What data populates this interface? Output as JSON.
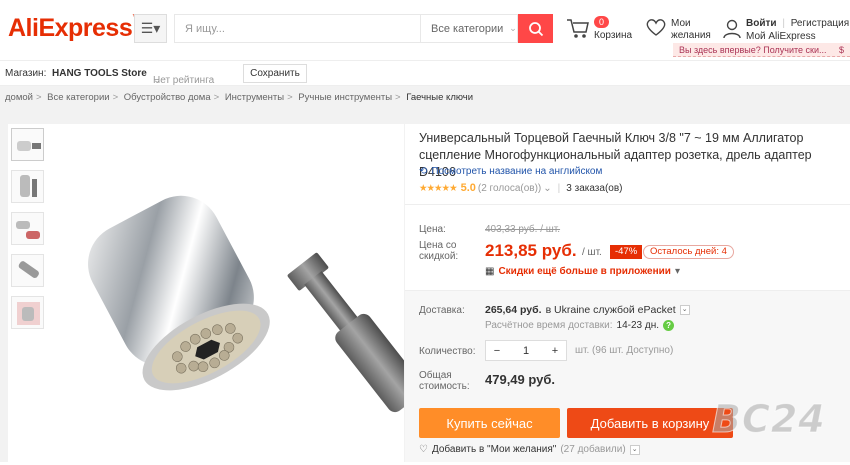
{
  "header": {
    "logo": "AliExpress",
    "search_placeholder": "Я ищу...",
    "search_category": "Все категории",
    "cart_count": "0",
    "cart_label": "Корзина",
    "wishlist_label": "Мои желания",
    "login": "Войти",
    "register": "Регистрация",
    "my_account": "Мой AliExpress",
    "promo": "Вы здесь впервые? Получите ски...",
    "promo_currency": "$"
  },
  "store_bar": {
    "store_label": "Магазин:",
    "store_name": "HANG TOOLS Store",
    "rating": "Нет рейтинга",
    "save": "Сохранить"
  },
  "breadcrumb": [
    "домой",
    "Все категории",
    "Обустройство дома",
    "Инструменты",
    "Ручные инструменты",
    "Гаечные ключи"
  ],
  "product": {
    "title": "Универсальный Торцевой Гаечный Ключ 3/8 \"7 ~ 19 мм Аллигатор сцепление Многофункциональный адаптер розетка, дрель адаптер D4106",
    "translate_link": "Посмотреть название на английском",
    "stars": "★★★★★",
    "rating": "5.0",
    "votes": "(2 голоса(ов))",
    "orders": "3 заказа(ов)",
    "price_label": "Цена:",
    "old_price": "403,33 руб. / шт.",
    "discount_label_line1": "Цена со",
    "discount_label_line2": "скидкой:",
    "price": "213,85 руб.",
    "per_unit": "/ шт.",
    "discount": "-47%",
    "days_left": "Осталось дней: 4",
    "app_deal": "Скидки ещё больше в приложении",
    "shipping_label": "Доставка:",
    "shipping_price": "265,64 руб.",
    "shipping_to": "в Ukraine службой ePacket",
    "delivery_time_label": "Расчётное время доставки:",
    "delivery_time": "14-23 дн.",
    "qty_label": "Количество:",
    "qty_minus": "−",
    "qty_value": "1",
    "qty_plus": "+",
    "qty_available": "шт. (96 шт. Доступно)",
    "total_label_line1": "Общая",
    "total_label_line2": "стоимость:",
    "total": "479,49 руб.",
    "buy_now": "Купить сейчас",
    "add_to_cart": "Добавить в корзину",
    "add_wishlist": "Добавить в \"Мои желания\"",
    "wishlist_count": "(27 добавили)"
  },
  "watermark": "BC24",
  "colors": {
    "brand": "#e62e04",
    "buy_button": "#ff8d28",
    "cart_button": "#ee4a16",
    "star": "#ffaa33"
  }
}
